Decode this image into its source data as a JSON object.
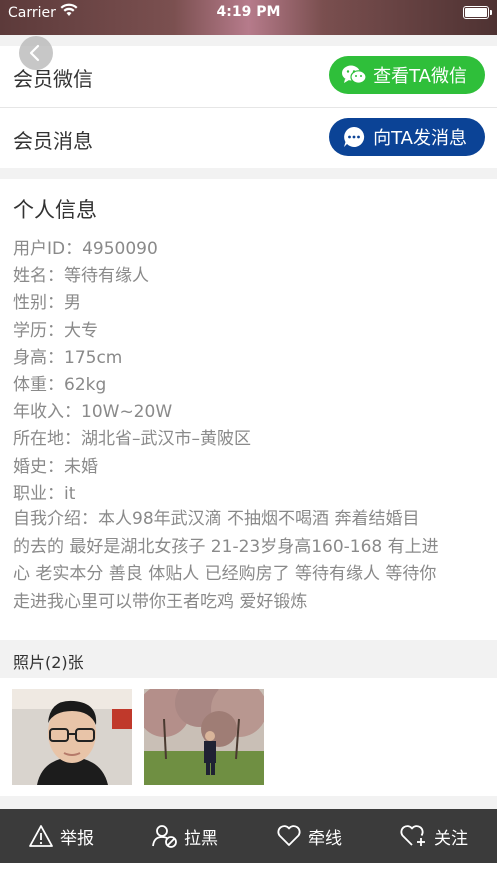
{
  "status_bar": {
    "carrier": "Carrier",
    "time": "4:19 PM"
  },
  "actions": {
    "wechat_label": "会员微信",
    "wechat_button": "查看TA微信",
    "message_label": "会员消息",
    "message_button": "向TA发消息"
  },
  "colors": {
    "wechat_green": "#2fbf3a",
    "message_blue": "#0b4396",
    "tabbar_bg": "#3b3b3b"
  },
  "profile": {
    "title": "个人信息",
    "lines": [
      "用户ID：4950090",
      "姓名：等待有缘人",
      "性别：男",
      "学历：大专",
      "身高：175cm",
      "体重：62kg",
      "年收入：10W~20W",
      "所在地：湖北省–武汉市–黄陂区",
      "婚史：未婚",
      "职业：it"
    ],
    "intro_lines": [
      "自我介绍：本人98年武汉滴 不抽烟不喝酒 奔着结婚目",
      "的去的 最好是湖北女孩子 21-23岁身高160-168 有上进",
      "心 老实本分 善良 体贴人 已经购房了 等待有缘人 等待你",
      "走进我心里可以带你王者吃鸡 爱好锻炼"
    ]
  },
  "photos": {
    "header": "照片(2)张"
  },
  "tabbar": {
    "report": "举报",
    "block": "拉黑",
    "match": "牵线",
    "follow": "关注"
  }
}
